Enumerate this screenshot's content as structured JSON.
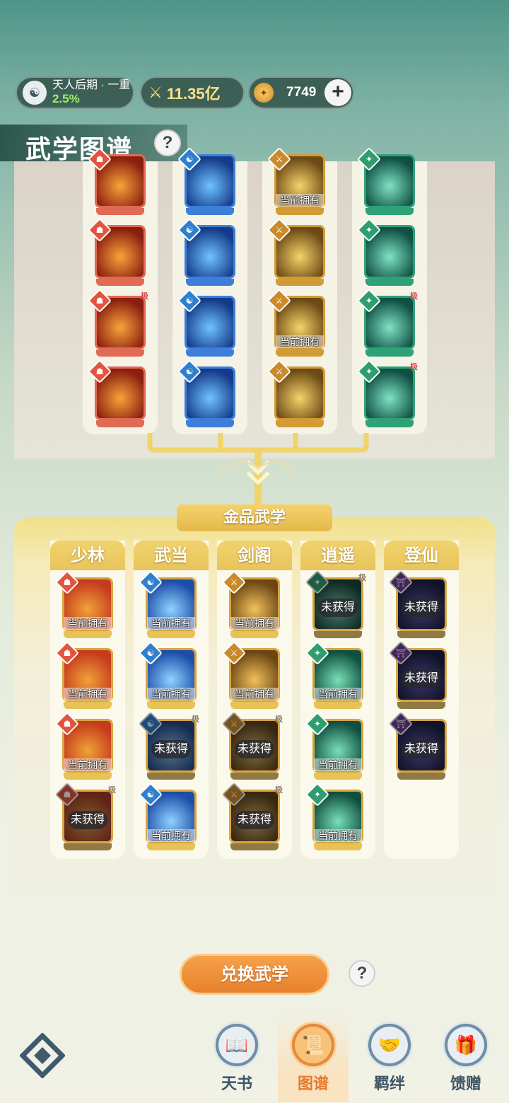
{
  "status": {
    "realm_name": "天人后期 · 一重",
    "realm_progress": "2.5%",
    "combat_power": "11.35亿",
    "currency_amount": "7749",
    "add_button": "+"
  },
  "page_title": "武学图谱",
  "help_label": "?",
  "upper_columns": [
    {
      "theme_color": "#e06a54",
      "badge_color": "#e2543f",
      "badge_glyph": "☗",
      "skills": [
        {
          "owned_label": "",
          "tier": ""
        },
        {
          "owned_label": "",
          "tier": ""
        },
        {
          "owned_label": "",
          "tier": "极"
        },
        {
          "owned_label": "",
          "tier": ""
        }
      ]
    },
    {
      "theme_color": "#3d7fd8",
      "badge_color": "#2f7fd0",
      "badge_glyph": "☯",
      "skills": [
        {
          "owned_label": "",
          "tier": ""
        },
        {
          "owned_label": "",
          "tier": ""
        },
        {
          "owned_label": "",
          "tier": ""
        },
        {
          "owned_label": "",
          "tier": ""
        }
      ]
    },
    {
      "theme_color": "#d39b35",
      "badge_color": "#c98a2c",
      "badge_glyph": "⚔",
      "skills": [
        {
          "owned_label": "当前拥有",
          "tier": ""
        },
        {
          "owned_label": "",
          "tier": ""
        },
        {
          "owned_label": "当前拥有",
          "tier": ""
        },
        {
          "owned_label": "",
          "tier": ""
        }
      ]
    },
    {
      "theme_color": "#2fa177",
      "badge_color": "#2f9d6f",
      "badge_glyph": "✦",
      "skills": [
        {
          "owned_label": "",
          "tier": ""
        },
        {
          "owned_label": "",
          "tier": ""
        },
        {
          "owned_label": "",
          "tier": "极"
        },
        {
          "owned_label": "",
          "tier": "极"
        }
      ]
    }
  ],
  "gold_section_title": "金品武学",
  "lower_columns": [
    {
      "name": "少林",
      "badge_color": "#e2543f",
      "badge_glyph": "☗",
      "palette": [
        "#c53b1b",
        "#f0a23a"
      ],
      "skills": [
        {
          "state": "owned",
          "label": "当前拥有",
          "tier": ""
        },
        {
          "state": "owned",
          "label": "当前拥有",
          "tier": ""
        },
        {
          "state": "owned",
          "label": "当前拥有",
          "tier": ""
        },
        {
          "state": "locked",
          "label": "未获得",
          "tier": "极"
        }
      ]
    },
    {
      "name": "武当",
      "badge_color": "#2f7fd0",
      "badge_glyph": "☯",
      "palette": [
        "#1c4da8",
        "#8fd2ff"
      ],
      "skills": [
        {
          "state": "owned",
          "label": "当前拥有",
          "tier": ""
        },
        {
          "state": "owned",
          "label": "当前拥有",
          "tier": ""
        },
        {
          "state": "locked",
          "label": "未获得",
          "tier": "极"
        },
        {
          "state": "owned",
          "label": "当前拥有",
          "tier": ""
        }
      ]
    },
    {
      "name": "剑阁",
      "badge_color": "#c98a2c",
      "badge_glyph": "⚔",
      "palette": [
        "#6b4614",
        "#f1c15a"
      ],
      "skills": [
        {
          "state": "owned",
          "label": "当前拥有",
          "tier": ""
        },
        {
          "state": "owned",
          "label": "当前拥有",
          "tier": ""
        },
        {
          "state": "locked",
          "label": "未获得",
          "tier": "极"
        },
        {
          "state": "locked",
          "label": "未获得",
          "tier": "极"
        }
      ]
    },
    {
      "name": "逍遥",
      "badge_color": "#2f9d6f",
      "badge_glyph": "✦",
      "palette": [
        "#0f4f3f",
        "#79e0b8"
      ],
      "skills": [
        {
          "state": "locked",
          "label": "未获得",
          "tier": "极"
        },
        {
          "state": "owned",
          "label": "当前拥有",
          "tier": ""
        },
        {
          "state": "owned",
          "label": "当前拥有",
          "tier": ""
        },
        {
          "state": "owned",
          "label": "当前拥有",
          "tier": ""
        }
      ]
    },
    {
      "name": "登仙",
      "badge_color": "#6e3a9a",
      "badge_glyph": "⛩",
      "palette": [
        "#1a2350",
        "#6f5fd0"
      ],
      "skills": [
        {
          "state": "locked",
          "label": "未获得",
          "tier": ""
        },
        {
          "state": "locked",
          "label": "未获得",
          "tier": ""
        },
        {
          "state": "locked",
          "label": "未获得",
          "tier": ""
        }
      ]
    }
  ],
  "exchange_button": "兑换武学",
  "nav": {
    "tabs": [
      {
        "label": "天书",
        "icon": "book-icon",
        "glyph": "📖",
        "active": false
      },
      {
        "label": "图谱",
        "icon": "map-icon",
        "glyph": "📜",
        "active": true
      },
      {
        "label": "羁绊",
        "icon": "handshake-icon",
        "glyph": "🤝",
        "active": false
      },
      {
        "label": "馈赠",
        "icon": "gift-bag-icon",
        "glyph": "🎁",
        "active": false
      }
    ]
  }
}
